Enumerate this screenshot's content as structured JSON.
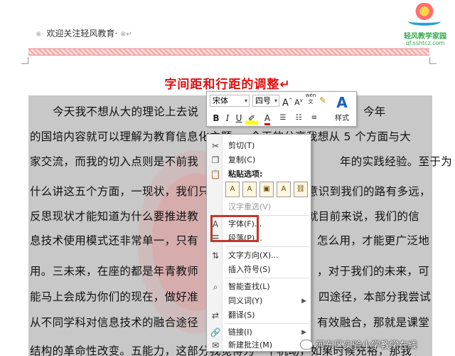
{
  "header": {
    "left_mark": "※·",
    "text": "欢迎关注轻风教育·",
    "right_mark": "※↵"
  },
  "logo": {
    "name": "轻风教学家园",
    "url": "qf.sshtcz.com"
  },
  "document": {
    "title": "字间距和行距的调整↵",
    "lines": [
      {
        "left": "今天我不想从大的理论上去说",
        "right": "在座很多，今年"
      },
      {
        "left": "的国培内容就可以理解为教育信息化主题，",
        "right": "今天的分享我想从  5  个方面与大"
      },
      {
        "left": "家交流，而我的切入点则是不前我",
        "right": "年的实践经验。至于为"
      },
      {
        "left": "什么讲这五个方面，一现状，我们只",
        "right": "意识到我们的路有多远，"
      },
      {
        "left": "反思现状才能知道为什么要推进教",
        "right": "就目前来说，我们的信"
      },
      {
        "left": "息技术使用模式还非常单一，只有",
        "right": "怎么用，才能更广泛地"
      },
      {
        "left": "用。三未来，在座的都是年青教师",
        "right": "，对于我们的未来，可"
      },
      {
        "left": "能马上会成为你们的现在，做好准",
        "right": "四途径，本部分我尝试"
      },
      {
        "left": "从不同学科对信息技术的融合途径",
        "right": "有效融合，那就是课堂"
      },
      {
        "left": "结构的革命性改变。五能力，这部分我觉得为一个机动，如果时候充裕，那我",
        "right": ""
      }
    ]
  },
  "mini_toolbar": {
    "font": "宋体",
    "size": "四号",
    "grow": "A",
    "shrink": "A",
    "phonetic": "wén",
    "bold": "B",
    "italic": "I",
    "underline": "U",
    "font_color": "A",
    "styles_label": "样式",
    "styles_glyph": "A"
  },
  "context_menu": {
    "cut": "剪切(T)",
    "copy": "复制(C)",
    "paste_options": "粘贴选项:",
    "reconvert": "汉字重选(V)",
    "font": "字体(F)...",
    "paragraph": "段落(P)...",
    "text_direction": "文字方向(X)...",
    "insert_symbol": "插入符号(S)",
    "smart_lookup": "智能查找(L)",
    "synonyms": "同义词(Y)",
    "translate": "翻译(S)",
    "link": "链接(I)",
    "new_comment": "新建批注(M)"
  },
  "watermark": {
    "text": "河东区实验小学教学在线"
  }
}
